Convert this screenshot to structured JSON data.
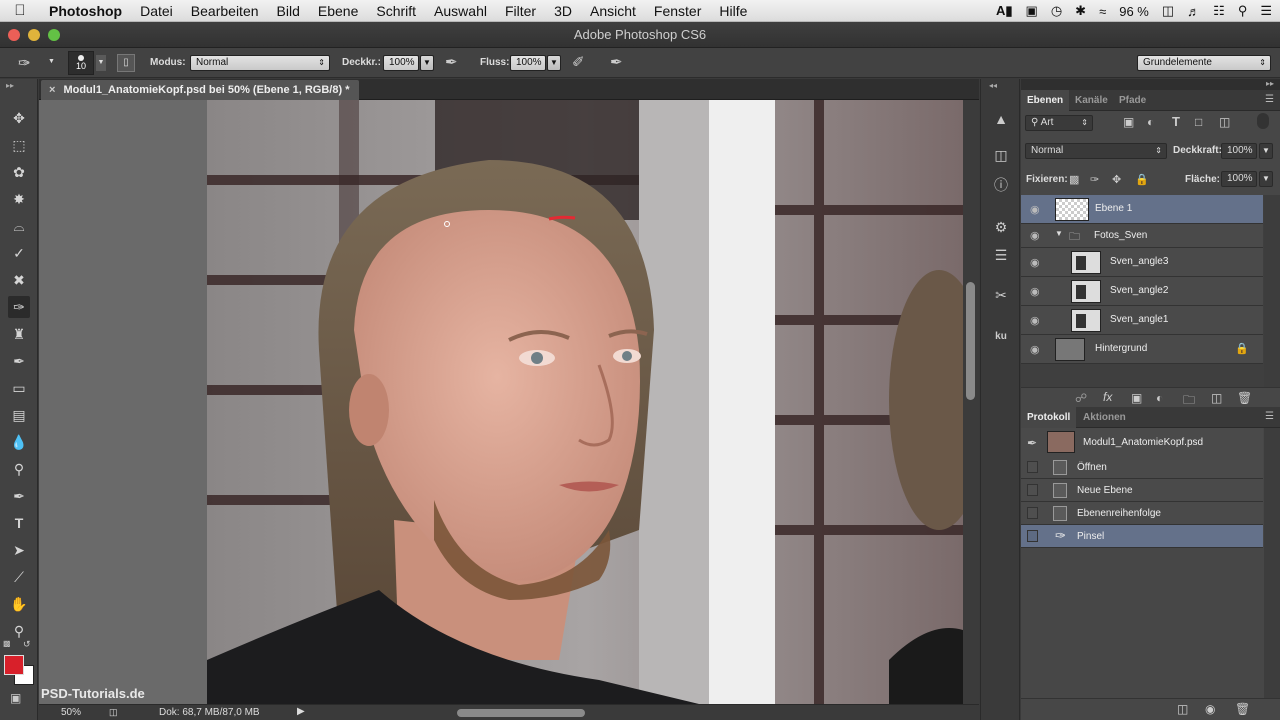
{
  "menubar": {
    "items": [
      "Photoshop",
      "Datei",
      "Bearbeiten",
      "Bild",
      "Ebene",
      "Schrift",
      "Auswahl",
      "Filter",
      "3D",
      "Ansicht",
      "Fenster",
      "Hilfe"
    ],
    "battery": "96 %"
  },
  "window": {
    "title": "Adobe Photoshop CS6"
  },
  "options": {
    "brush_size": "10",
    "mode_label": "Modus:",
    "mode_value": "Normal",
    "opacity_label": "Deckkr.:",
    "opacity_value": "100%",
    "flow_label": "Fluss:",
    "flow_value": "100%",
    "workspace": "Grundelemente"
  },
  "document": {
    "tab_title": "Modul1_AnatomieKopf.psd bei 50% (Ebene 1, RGB/8) *",
    "zoom": "50%",
    "doc_size": "Dok: 68,7 MB/87,0 MB",
    "watermark": "PSD-Tutorials.de"
  },
  "layers_panel": {
    "tabs": [
      "Ebenen",
      "Kanäle",
      "Pfade"
    ],
    "filter_kind": "Art",
    "blend_mode": "Normal",
    "opacity_label": "Deckkraft:",
    "opacity_value": "100%",
    "lock_label": "Fixieren:",
    "fill_label": "Fläche:",
    "fill_value": "100%",
    "layers": [
      {
        "name": "Ebene 1",
        "selected": true
      },
      {
        "name": "Fotos_Sven",
        "group": true
      },
      {
        "name": "Sven_angle3"
      },
      {
        "name": "Sven_angle2"
      },
      {
        "name": "Sven_angle1"
      },
      {
        "name": "Hintergrund",
        "locked": true
      }
    ]
  },
  "history_panel": {
    "tabs": [
      "Protokoll",
      "Aktionen"
    ],
    "snapshot": "Modul1_AnatomieKopf.psd",
    "steps": [
      "Öffnen",
      "Neue Ebene",
      "Ebenenreihenfolge",
      "Pinsel"
    ],
    "selected_step": "Pinsel"
  },
  "colors": {
    "foreground": "#d8202a",
    "background": "#ffffff",
    "selection": "#64718a"
  }
}
